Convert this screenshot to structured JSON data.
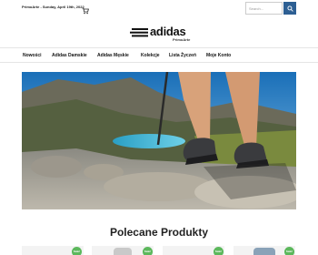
{
  "topbar": {
    "date": "PrimoArte - Sunday, April 19th, 2022",
    "search_placeholder": "Search..."
  },
  "logo": {
    "wordmark": "adidas",
    "subtitle": "PrimoArte"
  },
  "nav": {
    "items": [
      {
        "label": "Nowości"
      },
      {
        "label": "Adidas Damskie"
      },
      {
        "label": "Adidas Męskie"
      },
      {
        "label": "Kolekcje"
      },
      {
        "label": "Lista Życzeń"
      },
      {
        "label": "Moje Konto"
      }
    ]
  },
  "section": {
    "title": "Polecane Produkty"
  },
  "products": [
    {
      "badge": "Sale!"
    },
    {
      "badge": "Sale!"
    },
    {
      "badge": "Sale!"
    },
    {
      "badge": "Sale!"
    }
  ],
  "colors": {
    "accent": "#2d5f93",
    "sale_badge": "#5cb85c"
  }
}
